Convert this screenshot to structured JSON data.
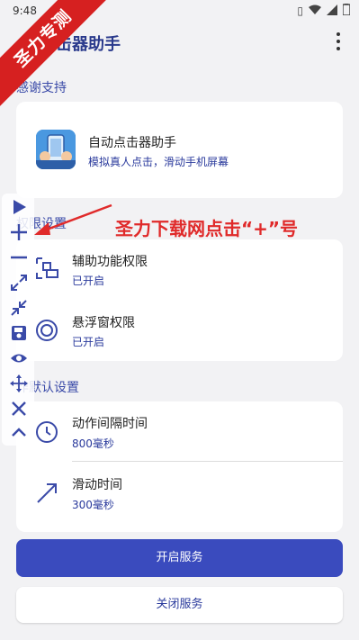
{
  "status_bar": {
    "time": "9:48"
  },
  "app_bar": {
    "title": "点击器助手"
  },
  "watermark": {
    "text": "圣力专测"
  },
  "sections": {
    "thanks": "感谢支持",
    "permissions": "权限设置",
    "defaults": "作默认设置"
  },
  "app_card": {
    "name": "自动点击器助手",
    "description": "模拟真人点击，滑动手机屏幕"
  },
  "permissions": [
    {
      "title": "辅助功能权限",
      "status": "已开启"
    },
    {
      "title": "悬浮窗权限",
      "status": "已开启"
    }
  ],
  "defaults": [
    {
      "title": "动作间隔时间",
      "value": "800毫秒"
    },
    {
      "title": "滑动时间",
      "value": "300毫秒"
    }
  ],
  "buttons": {
    "start": "开启服务",
    "stop": "关闭服务"
  },
  "promo": {
    "text": "圣力下载网点击“+”号"
  },
  "colors": {
    "accent": "#3a4bbe",
    "promo": "#e02a2a",
    "banner": "#d62020"
  }
}
